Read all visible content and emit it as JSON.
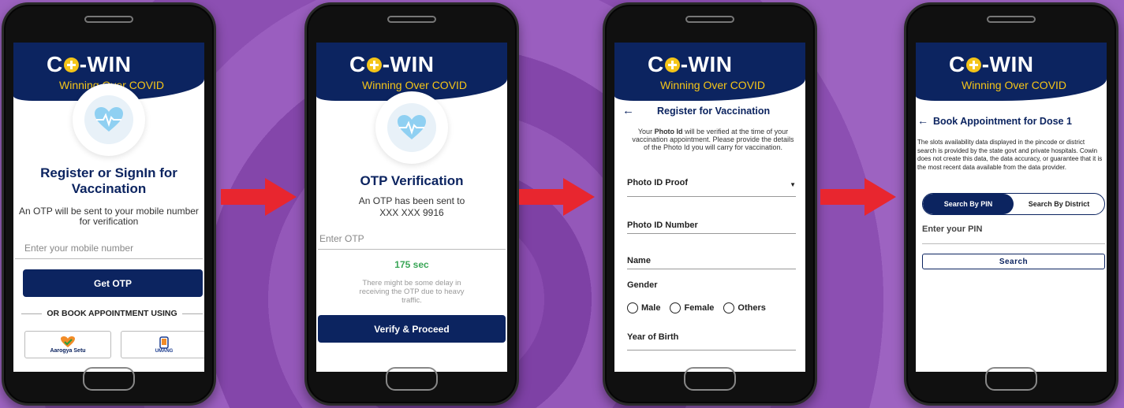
{
  "app": {
    "logo_text_left": "C",
    "logo_text_right": "-WIN",
    "tagline": "Winning Over COVID"
  },
  "screen1": {
    "title": "Register or SignIn for Vaccination",
    "subtitle": "An OTP will be sent to your mobile number for verification",
    "mobile_placeholder": "Enter your mobile number",
    "get_otp_label": "Get OTP",
    "or_book_label": "OR BOOK APPOINTMENT USING",
    "aarogya_label": "Aarogya Setu",
    "umang_label": "UMANG"
  },
  "screen2": {
    "title": "OTP Verification",
    "sent_line1": "An OTP has been sent to",
    "sent_line2": "XXX XXX 9916",
    "otp_placeholder": "Enter OTP",
    "timer": "175 sec",
    "delay_note": "There might be some delay in receiving the OTP due to heavy traffic.",
    "verify_label": "Verify & Proceed"
  },
  "screen3": {
    "back_arrow": "←",
    "title": "Register for Vaccination",
    "note_prefix": "Your ",
    "note_bold": "Photo Id",
    "note_suffix": " will be verified at the time of your vaccination appointment. Please provide the details of the Photo Id you will carry for vaccination.",
    "photo_id_proof_label": "Photo ID Proof",
    "photo_id_number_label": "Photo ID Number",
    "name_label": "Name",
    "gender_label": "Gender",
    "gender_options": [
      "Male",
      "Female",
      "Others"
    ],
    "year_of_birth_label": "Year of Birth"
  },
  "screen4": {
    "back_arrow": "←",
    "title": "Book Appointment for Dose 1",
    "disclaimer": "The slots availability data displayed in the pincode or district search is provided by the state govt and private hospitals. Cowin does not create this data, the data accuracy, or guarantee that it is the most recent data available from the data provider.",
    "tab_pin_label": "Search By PIN",
    "tab_district_label": "Search By District",
    "pin_placeholder": "Enter your PIN",
    "search_label": "Search"
  },
  "colors": {
    "navy": "#0c2460",
    "yellow": "#f5c518",
    "arrow_red": "#e8262f",
    "timer_green": "#3aa657"
  }
}
